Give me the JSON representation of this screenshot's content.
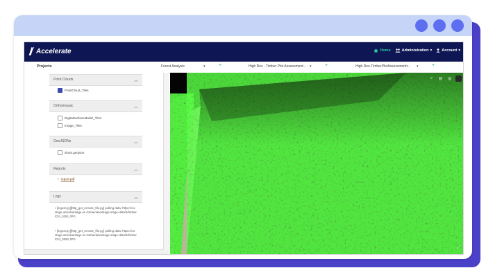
{
  "app": {
    "name": "Accelerate",
    "nav": [
      {
        "label": "Home",
        "icon": "home-icon",
        "caret": ""
      },
      {
        "label": "Administration",
        "icon": "users-icon",
        "caret": "▾"
      },
      {
        "label": "Account",
        "icon": "user-icon",
        "caret": "▾"
      }
    ]
  },
  "tabs": {
    "projects": "Projects",
    "views": [
      {
        "label": "Forest Analysis"
      },
      {
        "label": "High Res - Timber Plot Assessment..."
      },
      {
        "label": "High Res-TimberPlotAssessmentt..."
      }
    ]
  },
  "sidebar": {
    "point_clouds": {
      "title": "Point Clouds",
      "items": [
        {
          "label": "PointCloud_Tiles",
          "checked": true
        }
      ]
    },
    "orthomosaic": {
      "title": "Orthomosaic",
      "items": [
        {
          "label": "DigitalSurfaceModel_Tiles",
          "checked": false
        },
        {
          "label": "Image_Tiles",
          "checked": false
        }
      ]
    },
    "geojsons": {
      "title": "GeoJSONs",
      "items": [
        {
          "label": "shots.geojson",
          "checked": false
        }
      ]
    },
    "reports": {
      "title": "Reports",
      "items": [
        {
          "label": "report.pdf"
        }
      ]
    },
    "logs": {
      "title": "Logs",
      "entries": [
        "[ingest.py][http_get_remote_file.py] pulling data: https://ov-stage.aerialvantage.us /s3/aerialvantage.stage-data/3/timber /DJI_0391.JPG",
        "[ingest.py][http_get_remote_file.py] pulling data: https://ov-stage.aerialvantage.us /s3/aerialvantage.stage-data/3/timber /DJI_0392.JPG"
      ]
    }
  },
  "viewer": {
    "tools": [
      {
        "icon": "search-icon",
        "glyph": "⌕"
      },
      {
        "icon": "layers-icon",
        "glyph": "▤"
      },
      {
        "icon": "globe-icon",
        "glyph": "◍"
      },
      {
        "icon": "square-icon",
        "glyph": ""
      }
    ],
    "fullscreen_glyph": "⤢"
  },
  "colors": {
    "navbar": "#0e1653",
    "home_accent": "#31c3a3",
    "frame_top": "#c6d4f7",
    "frame_dots": "#5d6ef0",
    "frame_shadow": "#4b40c8"
  }
}
